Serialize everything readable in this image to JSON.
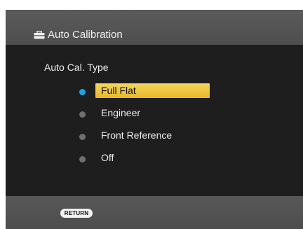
{
  "header": {
    "icon": "toolbox-icon",
    "title": "Auto Calibration"
  },
  "main": {
    "section_label": "Auto Cal. Type",
    "options": [
      {
        "label": "Full Flat",
        "selected": true
      },
      {
        "label": "Engineer",
        "selected": false
      },
      {
        "label": "Front Reference",
        "selected": false
      },
      {
        "label": "Off",
        "selected": false
      }
    ]
  },
  "footer": {
    "return_label": "RETURN"
  },
  "colors": {
    "selected_dot": "#1fa4e8",
    "unselected_dot": "#6f6f6f",
    "highlight": "#f0c842"
  }
}
